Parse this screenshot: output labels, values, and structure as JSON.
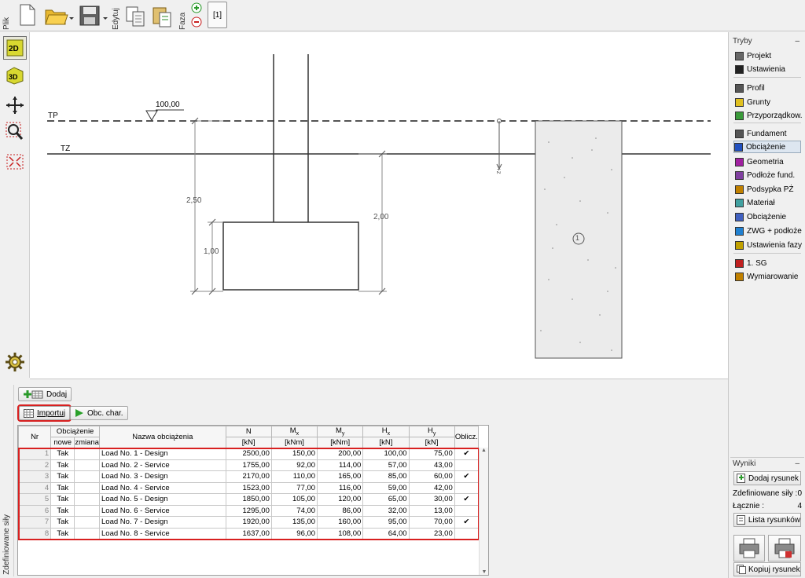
{
  "toolbar": {
    "file_label": "Plik",
    "edit_label": "Edytuj",
    "phase_label": "Faza",
    "phase_tab": "[1]"
  },
  "drawing": {
    "tp_label": "TP",
    "tz_label": "TZ",
    "level_label": "100,00",
    "dim_250": "2,50",
    "dim_100": "1,00",
    "dim_200": "2,00",
    "soil_number": "1",
    "z_label": "+z"
  },
  "bottom_panel": {
    "side_label": "Zdefiniowane siły",
    "add_button": "Dodaj",
    "import_button": "Importuj",
    "calc_button": "Obc. char.",
    "columns": {
      "nr": "Nr",
      "load": "Obciążenie",
      "load_new": "nowe",
      "load_change": "zmiana",
      "name": "Nazwa obciążenia",
      "n": "N",
      "n_unit": "[kN]",
      "mx": "Mx",
      "mx_unit": "[kNm]",
      "my": "My",
      "my_unit": "[kNm]",
      "hx": "Hx",
      "hx_unit": "[kN]",
      "hy": "Hy",
      "hy_unit": "[kN]",
      "calc": "Oblicz."
    },
    "rows": [
      {
        "nr": "1",
        "new": "Tak",
        "change": "",
        "name": "Load No. 1 - Design",
        "n": "2500,00",
        "mx": "150,00",
        "my": "200,00",
        "hx": "100,00",
        "hy": "75,00",
        "calc": "✔"
      },
      {
        "nr": "2",
        "new": "Tak",
        "change": "",
        "name": "Load No. 2 - Service",
        "n": "1755,00",
        "mx": "92,00",
        "my": "114,00",
        "hx": "57,00",
        "hy": "43,00",
        "calc": ""
      },
      {
        "nr": "3",
        "new": "Tak",
        "change": "",
        "name": "Load No. 3 - Design",
        "n": "2170,00",
        "mx": "110,00",
        "my": "165,00",
        "hx": "85,00",
        "hy": "60,00",
        "calc": "✔"
      },
      {
        "nr": "4",
        "new": "Tak",
        "change": "",
        "name": "Load No. 4 - Service",
        "n": "1523,00",
        "mx": "77,00",
        "my": "116,00",
        "hx": "59,00",
        "hy": "42,00",
        "calc": ""
      },
      {
        "nr": "5",
        "new": "Tak",
        "change": "",
        "name": "Load No. 5 - Design",
        "n": "1850,00",
        "mx": "105,00",
        "my": "120,00",
        "hx": "65,00",
        "hy": "30,00",
        "calc": "✔"
      },
      {
        "nr": "6",
        "new": "Tak",
        "change": "",
        "name": "Load No. 6 - Service",
        "n": "1295,00",
        "mx": "74,00",
        "my": "86,00",
        "hx": "32,00",
        "hy": "13,00",
        "calc": ""
      },
      {
        "nr": "7",
        "new": "Tak",
        "change": "",
        "name": "Load No. 7 - Design",
        "n": "1920,00",
        "mx": "135,00",
        "my": "160,00",
        "hx": "95,00",
        "hy": "70,00",
        "calc": "✔"
      },
      {
        "nr": "8",
        "new": "Tak",
        "change": "",
        "name": "Load No. 8 - Service",
        "n": "1637,00",
        "mx": "96,00",
        "my": "108,00",
        "hx": "64,00",
        "hy": "23,00",
        "calc": ""
      }
    ]
  },
  "right_panel": {
    "modes_title": "Tryby",
    "collapse": "–",
    "items": [
      {
        "label": "Projekt",
        "icon": "project-icon",
        "color": "#666"
      },
      {
        "label": "Ustawienia",
        "icon": "settings-icon",
        "color": "#222"
      },
      {
        "label": "Profil",
        "icon": "profile-icon",
        "color": "#555"
      },
      {
        "label": "Grunty",
        "icon": "soils-icon",
        "color": "#e0c020"
      },
      {
        "label": "Przyporządkow.",
        "icon": "assign-icon",
        "color": "#3a9a3a"
      },
      {
        "label": "Fundament",
        "icon": "foundation-icon",
        "color": "#555"
      },
      {
        "label": "Obciążenie",
        "icon": "load-icon",
        "color": "#2050c0"
      },
      {
        "label": "Geometria",
        "icon": "geometry-icon",
        "color": "#a020a0"
      },
      {
        "label": "Podłoże fund.",
        "icon": "subsoil-icon",
        "color": "#8040a0"
      },
      {
        "label": "Podsypka PŻ",
        "icon": "sand-bed-icon",
        "color": "#c08000"
      },
      {
        "label": "Materiał",
        "icon": "material-icon",
        "color": "#40a0a0"
      },
      {
        "label": "Obciążenie",
        "icon": "surcharge-icon",
        "color": "#4060c0"
      },
      {
        "label": "ZWG + podłoże",
        "icon": "water-icon",
        "color": "#2080d0"
      },
      {
        "label": "Ustawienia fazy",
        "icon": "stage-settings-icon",
        "color": "#c0a000"
      },
      {
        "label": "1. SG",
        "icon": "sg-icon",
        "color": "#c02020"
      },
      {
        "label": "Wymiarowanie",
        "icon": "dimensioning-icon",
        "color": "#c08000"
      }
    ],
    "results_title": "Wyniki",
    "add_drawing": "Dodaj rysunek",
    "defined_forces_label": "Zdefiniowane siły :",
    "defined_forces_value": "0",
    "total_label": "Łącznie :",
    "total_value": "4",
    "drawings_list": "Lista rysunków",
    "copy_view": "Kopiuj rysunek"
  }
}
